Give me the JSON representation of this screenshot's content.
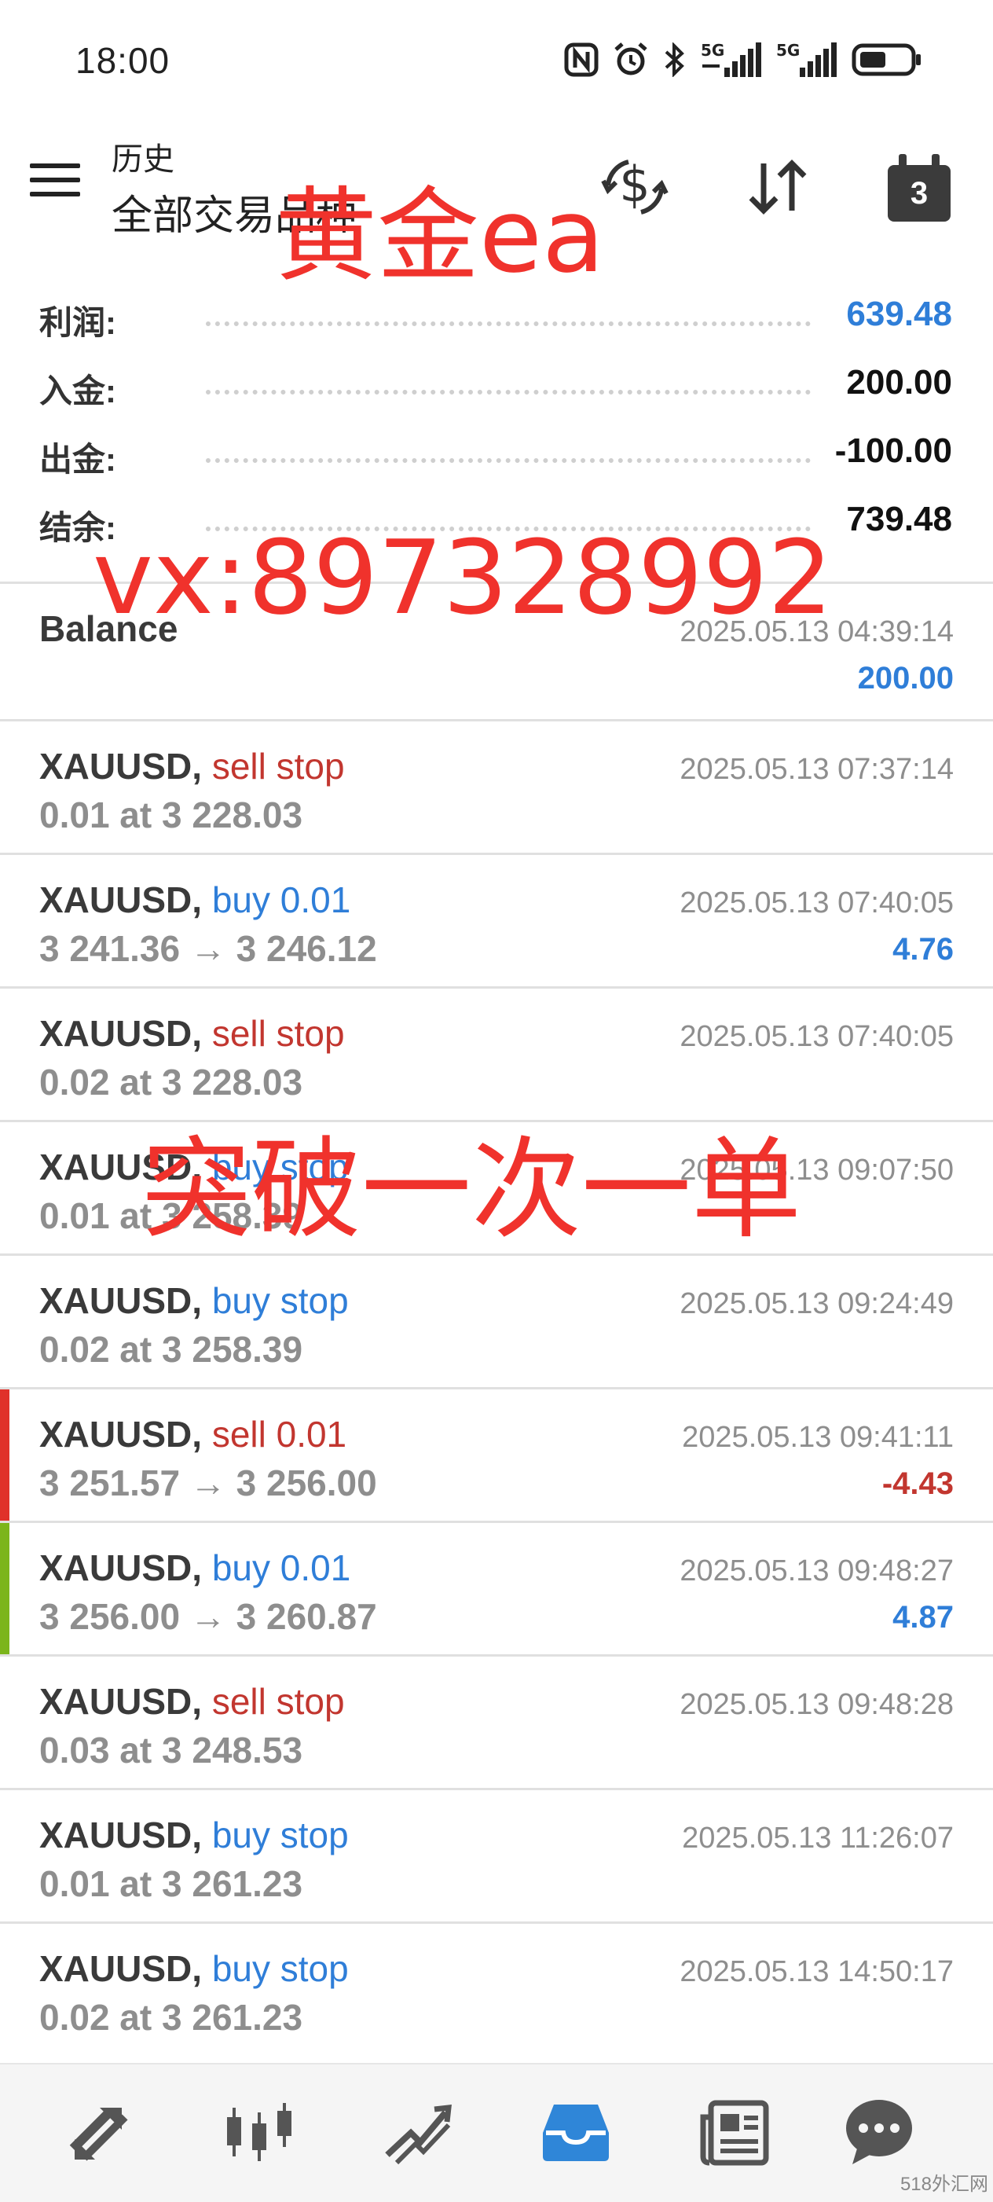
{
  "status_bar": {
    "time": "18:00",
    "icons": [
      "nfc-icon",
      "alarm-icon",
      "bluetooth-icon",
      "signal-5g-icon",
      "signal-5g-icon",
      "battery-icon"
    ],
    "network_label": "5G"
  },
  "header": {
    "subtitle": "历史",
    "title": "全部交易品种",
    "calendar_badge": "3"
  },
  "summary": [
    {
      "label": "利润:",
      "value": "639.48",
      "color": "#2f7ed8"
    },
    {
      "label": "入金:",
      "value": "200.00",
      "color": "#111111"
    },
    {
      "label": "出金:",
      "value": "-100.00",
      "color": "#111111"
    },
    {
      "label": "结余:",
      "value": "739.48",
      "color": "#111111"
    }
  ],
  "deals": [
    {
      "symbol": "Balance",
      "action": "",
      "detail": "",
      "time": "2025.05.13 04:39:14",
      "profit": "200.00"
    },
    {
      "symbol": "XAUUSD,",
      "action": "sell stop",
      "detail": "0.01 at 3 228.03",
      "time": "2025.05.13 07:37:14",
      "profit": ""
    },
    {
      "symbol": "XAUUSD,",
      "action": "buy 0.01",
      "detail": "3 241.36 → 3 246.12",
      "time": "2025.05.13 07:40:05",
      "profit": "4.76"
    },
    {
      "symbol": "XAUUSD,",
      "action": "sell stop",
      "detail": "0.02 at 3 228.03",
      "time": "2025.05.13 07:40:05",
      "profit": ""
    },
    {
      "symbol": "XAUUSD,",
      "action": "buy stop",
      "detail": "0.01 at 3 258.39",
      "time": "2025.05.13 09:07:50",
      "profit": ""
    },
    {
      "symbol": "XAUUSD,",
      "action": "buy stop",
      "detail": "0.02 at 3 258.39",
      "time": "2025.05.13 09:24:49",
      "profit": ""
    },
    {
      "symbol": "XAUUSD,",
      "action": "sell 0.01",
      "detail": "3 251.57 → 3 256.00",
      "time": "2025.05.13 09:41:11",
      "profit": "-4.43"
    },
    {
      "symbol": "XAUUSD,",
      "action": "buy 0.01",
      "detail": "3 256.00 → 3 260.87",
      "time": "2025.05.13 09:48:27",
      "profit": "4.87"
    },
    {
      "symbol": "XAUUSD,",
      "action": "sell stop",
      "detail": "0.03 at 3 248.53",
      "time": "2025.05.13 09:48:28",
      "profit": ""
    },
    {
      "symbol": "XAUUSD,",
      "action": "buy stop",
      "detail": "0.01 at 3 261.23",
      "time": "2025.05.13 11:26:07",
      "profit": ""
    },
    {
      "symbol": "XAUUSD,",
      "action": "buy stop",
      "detail": "0.02 at 3 261.23",
      "time": "2025.05.13 14:50:17",
      "profit": ""
    }
  ],
  "bottom_nav": [
    {
      "icon": "quotes-icon",
      "active": false
    },
    {
      "icon": "chart-icon",
      "active": false
    },
    {
      "icon": "trade-icon",
      "active": false
    },
    {
      "icon": "history-icon",
      "active": true
    },
    {
      "icon": "news-icon",
      "active": false
    },
    {
      "icon": "chat-icon",
      "active": false
    }
  ],
  "watermarks": [
    "黄金ea",
    "vx:897328992",
    "突破一次一单"
  ],
  "corner_logo": "518外汇网",
  "colors": {
    "buy": "#2f7ed8",
    "sell": "#c2362f",
    "loss_marker": "#e0312a",
    "profit_marker": "#7cb51b",
    "watermark": "#f0322c",
    "nav_active": "#2f86d8"
  }
}
